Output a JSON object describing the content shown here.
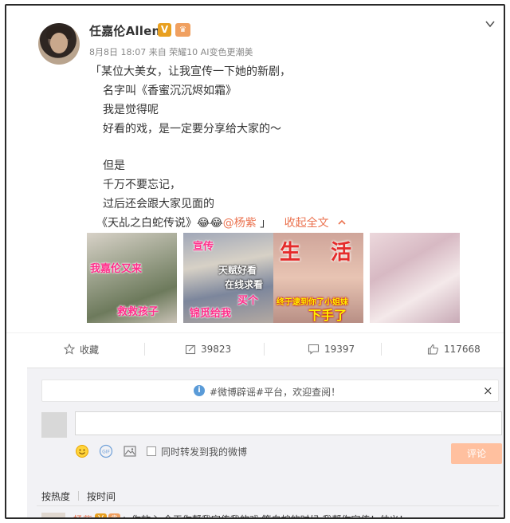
{
  "post": {
    "username": "任嘉伦Allen",
    "verified_badge": "V",
    "meta": "8月8日 18:07 来自 荣耀10 AI变色更潮美",
    "lines": [
      "「某位大美女，让我宣传一下她的新剧，",
      "名字叫《香蜜沉沉烬如霜》",
      "我是觉得呢",
      "好看的戏，是一定要分享给大家的～",
      "但是",
      "千万不要忘记，",
      "过后还会跟大家见面的"
    ],
    "last_line": {
      "title": "《天乩之白蛇传说》",
      "emoji": "😂😂",
      "mention": "@杨紫",
      "close_quote": "」",
      "collapse_label": "收起全文",
      "collapse_icon": "chevron-up-icon"
    },
    "images": [
      {
        "captions": [
          "我嘉伦又来",
          "救救孩子"
        ]
      },
      {
        "captions": [
          "宣传",
          "天赋好看",
          "在线求看",
          "锦觅给我",
          "买个"
        ]
      },
      {
        "captions": [
          "生",
          "活",
          "终于逮到你了小姐妹",
          "下手了"
        ]
      },
      {
        "captions": []
      }
    ]
  },
  "actions": {
    "favorite": "收藏",
    "repost_count": "39823",
    "comment_count": "19397",
    "like_count": "117668"
  },
  "comment_panel": {
    "notice": "#微博辟谣#平台，欢迎查阅！",
    "notice_close": "×",
    "input_placeholder": "",
    "repost_label": "同时转发到我的微博",
    "submit_label": "评论",
    "sort_hot": "按热度",
    "sort_time": "按时间",
    "first_comment": {
      "name": "杨紫",
      "badge": "V",
      "text": "：你放心 今天你帮我宣传我的戏 等白蛇的时候 我帮你宣传！仗义！"
    }
  },
  "colors": {
    "accent": "#eb7350",
    "vip_badge": "#e8a020",
    "submit_disabled": "#ffc09f"
  }
}
